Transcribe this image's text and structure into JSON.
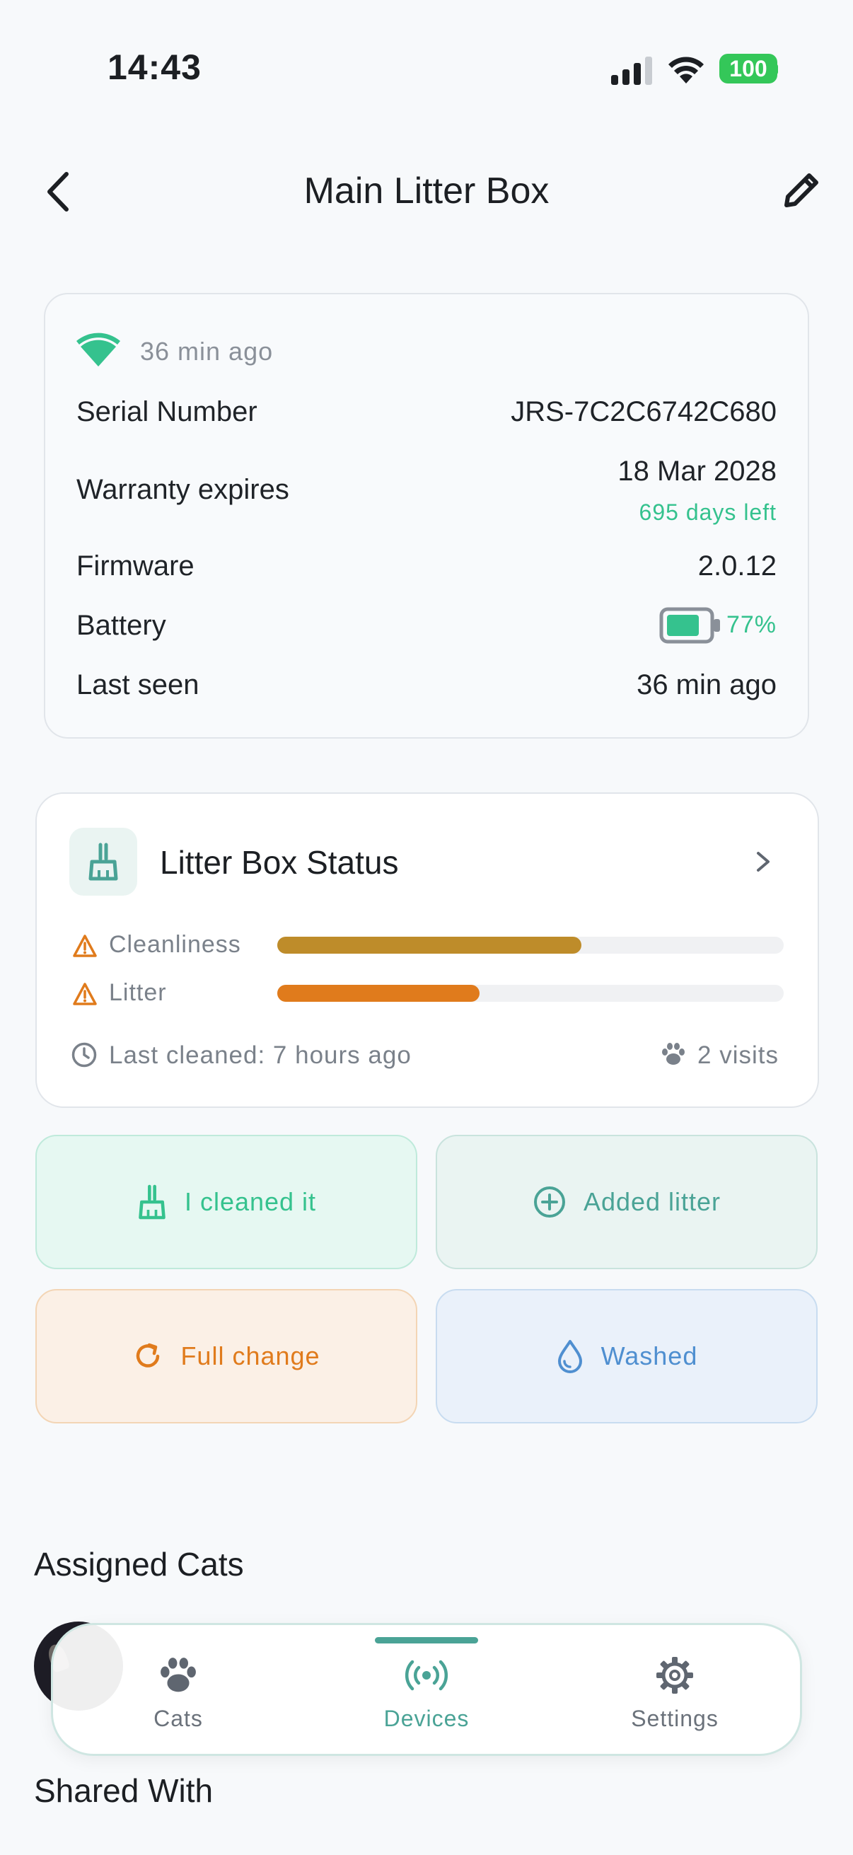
{
  "status_bar": {
    "time": "14:43",
    "battery": "100"
  },
  "header": {
    "title": "Main Litter Box"
  },
  "device": {
    "connection_ago": "36 min ago",
    "rows": {
      "serial_label": "Serial Number",
      "serial_value": "JRS-7C2C6742C680",
      "warranty_label": "Warranty expires",
      "warranty_value": "18 Mar 2028",
      "warranty_days": "695 days left",
      "firmware_label": "Firmware",
      "firmware_value": "2.0.12",
      "battery_label": "Battery",
      "battery_value": "77%",
      "battery_level": 0.77,
      "last_seen_label": "Last seen",
      "last_seen_value": "36 min ago"
    }
  },
  "status": {
    "title": "Litter Box Status",
    "meters": [
      {
        "label": "Cleanliness",
        "level": 0.6,
        "color": "#be8c2a"
      },
      {
        "label": "Litter",
        "level": 0.4,
        "color": "#e07b1c"
      }
    ],
    "last_cleaned": "Last cleaned: 7 hours ago",
    "visits": "2 visits"
  },
  "actions": {
    "cleaned": "I cleaned it",
    "added_litter": "Added litter",
    "full_change": "Full change",
    "washed": "Washed"
  },
  "sections": {
    "assigned_cats": "Assigned Cats",
    "shared_with": "Shared With"
  },
  "tabs": {
    "cats": "Cats",
    "devices": "Devices",
    "settings": "Settings"
  },
  "colors": {
    "accent": "#4aa396",
    "green": "#35c28e",
    "warning": "#e07b1c",
    "blue": "#4f8fd0"
  }
}
